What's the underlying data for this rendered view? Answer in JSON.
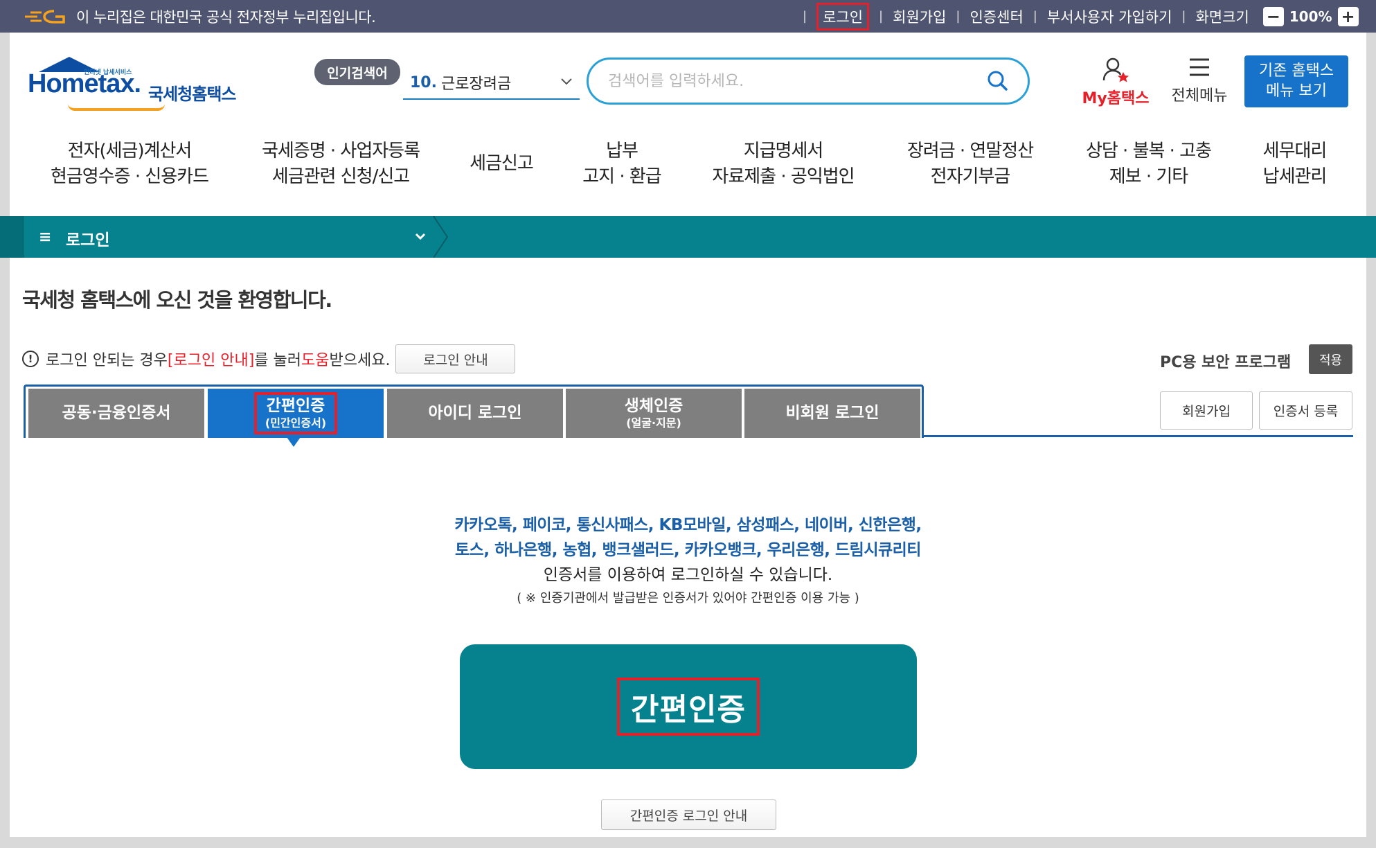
{
  "govbar": {
    "notice": "이 누리집은 대한민국 공식 전자정부 누리집입니다.",
    "links": [
      "로그인",
      "회원가입",
      "인증센터",
      "부서사용자 가입하기",
      "화면크기"
    ],
    "zoom": "100%"
  },
  "logo": {
    "small": "인터넷 납세서비스",
    "main": "Hometax.",
    "korean": "국세청홈택스"
  },
  "search": {
    "popular_label": "인기검색어",
    "popular_num": "10.",
    "popular_term": "근로장려금",
    "placeholder": "검색어를 입력하세요."
  },
  "header": {
    "my_hometax": "My홈택스",
    "all_menu": "전체메뉴",
    "old_menu_line1": "기존 홈택스",
    "old_menu_line2": "메뉴 보기"
  },
  "gnb": [
    {
      "l1": "전자(세금)계산서",
      "l2": "현금영수증 · 신용카드"
    },
    {
      "l1": "국세증명 · 사업자등록",
      "l2": "세금관련 신청/신고"
    },
    {
      "l1": "세금신고",
      "l2": ""
    },
    {
      "l1": "납부",
      "l2": "고지 · 환급"
    },
    {
      "l1": "지급명세서",
      "l2": "자료제출 · 공익법인"
    },
    {
      "l1": "장려금 · 연말정산",
      "l2": "전자기부금"
    },
    {
      "l1": "상담 · 불복 · 고충",
      "l2": "제보 · 기타"
    },
    {
      "l1": "세무대리",
      "l2": "납세관리"
    }
  ],
  "location": {
    "label": "로그인"
  },
  "page": {
    "welcome": "국세청 홈택스에 오신 것을 환영합니다.",
    "help_pre": "로그인 안되는 경우 ",
    "help_link": "[로그인 안내]",
    "help_mid": "를 눌러 ",
    "help_red2": "도움",
    "help_post": "받으세요.",
    "help_btn": "로그인 안내",
    "pc_security": "PC용 보안 프로그램",
    "apply": "적용",
    "signup": "회원가입",
    "cert_register": "인증서 등록"
  },
  "tabs": [
    {
      "label": "공동·금융인증서",
      "sub": ""
    },
    {
      "label": "간편인증",
      "sub": "(민간인증서)"
    },
    {
      "label": "아이디 로그인",
      "sub": ""
    },
    {
      "label": "생체인증",
      "sub": "(얼굴·지문)"
    },
    {
      "label": "비회원 로그인",
      "sub": ""
    }
  ],
  "content": {
    "providers_line1": "카카오톡, 페이코, 통신사패스, KB모바일, 삼성패스, 네이버, 신한은행,",
    "providers_line2": "토스, 하나은행, 농협, 뱅크샐러드, 카카오뱅크, 우리은행, 드림시큐리티",
    "usage": "인증서를 이용하여 로그인하실 수 있습니다.",
    "note": "( ※ 인증기관에서 발급받은 인증서가 있어야 간편인증 이용 가능 )",
    "simple_auth_btn": "간편인증",
    "guide_btn": "간편인증 로그인 안내"
  },
  "colors": {
    "teal": "#06828f",
    "blue": "#1673c9",
    "highlight": "#e4212a"
  }
}
